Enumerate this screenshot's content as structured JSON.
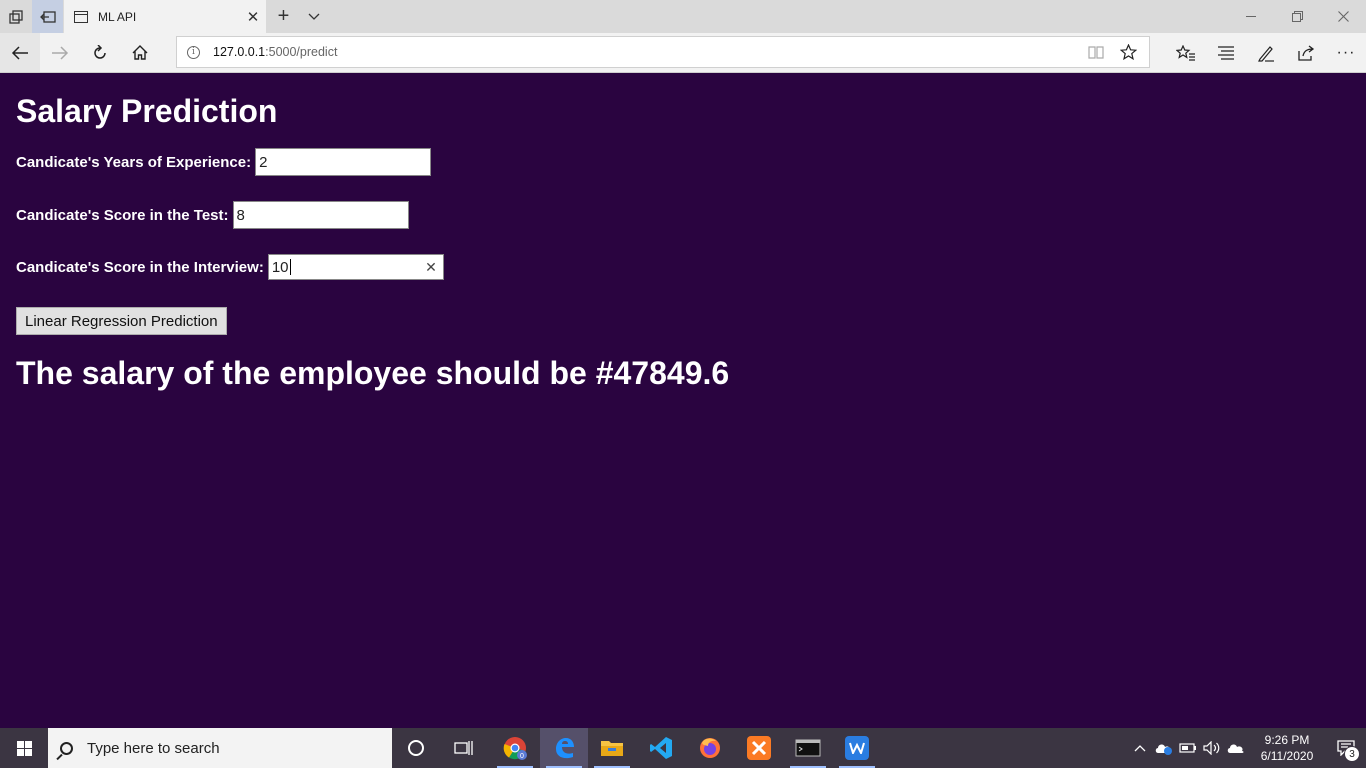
{
  "browser": {
    "tab_title": "ML API",
    "address": {
      "host": "127.0.0.1",
      "path": ":5000/predict"
    }
  },
  "page": {
    "title": "Salary Prediction",
    "fields": [
      {
        "label": "Candicate's Years of Experience:",
        "value": "2"
      },
      {
        "label": "Candicate's Score in the Test:",
        "value": "8"
      },
      {
        "label": "Candicate's Score in the Interview:",
        "value": "10"
      }
    ],
    "button_label": "Linear Regression Prediction",
    "result_text": "The salary of the employee should be #47849.6",
    "background_color": "#2a0440"
  },
  "taskbar": {
    "search_placeholder": "Type here to search",
    "time": "9:26 PM",
    "date": "6/11/2020",
    "notification_count": "3",
    "chrome_badge": "0"
  }
}
